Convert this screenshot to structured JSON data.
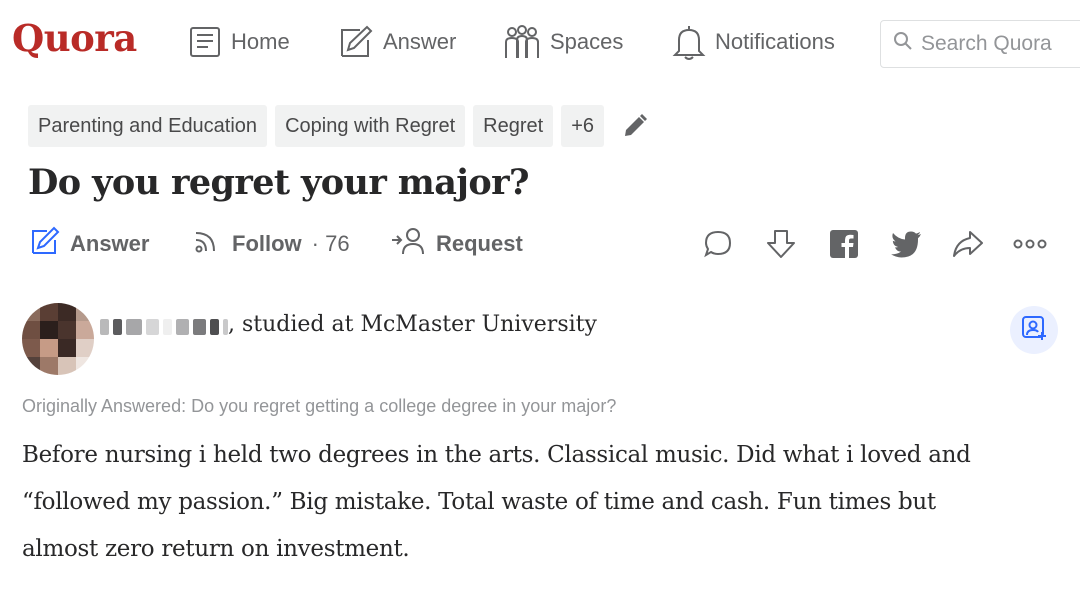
{
  "nav": {
    "logo": "Quora",
    "items": [
      {
        "label": "Home",
        "icon": "home-icon"
      },
      {
        "label": "Answer",
        "icon": "answer-pencil-icon"
      },
      {
        "label": "Spaces",
        "icon": "spaces-icon"
      },
      {
        "label": "Notifications",
        "icon": "bell-icon"
      }
    ],
    "search_placeholder": "Search Quora"
  },
  "topics": [
    "Parenting and Education",
    "Coping with Regret",
    "Regret",
    "+6"
  ],
  "question": {
    "title": "Do you regret your major?"
  },
  "actions": {
    "answer_label": "Answer",
    "follow_label": "Follow",
    "follow_count": "· 76",
    "request_label": "Request"
  },
  "answer": {
    "credential": ", studied at McMaster University",
    "originally_answered": "Originally Answered: Do you regret getting a college degree in your major?",
    "body_lines": [
      "Before nursing i held two degrees in the arts. Classical music. Did what i loved and",
      "“followed my passion.” Big mistake. Total waste of time and cash. Fun times but",
      "almost zero return on investment."
    ]
  },
  "colors": {
    "brand": "#b92b27",
    "accent": "#2e69ff",
    "icon_gray": "#636466",
    "chip_bg": "#f1f2f2"
  }
}
